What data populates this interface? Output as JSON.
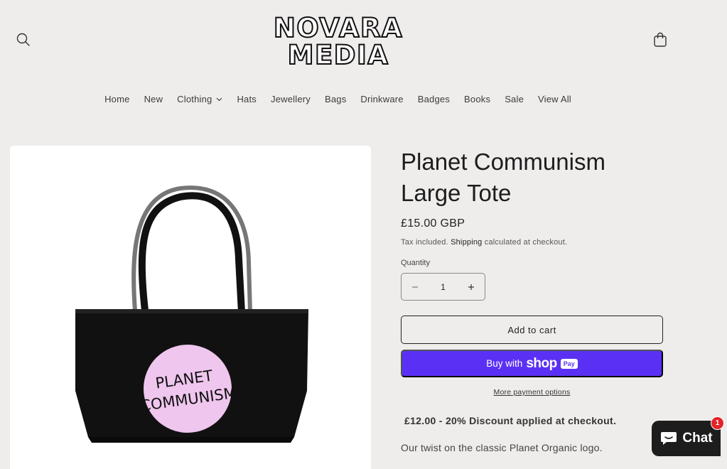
{
  "brand": {
    "logo_line1": "NOVARA",
    "logo_line2": "MEDIA"
  },
  "nav": {
    "items": [
      "Home",
      "New",
      "Clothing",
      "Hats",
      "Jewellery",
      "Bags",
      "Drinkware",
      "Badges",
      "Books",
      "Sale",
      "View All"
    ]
  },
  "product": {
    "title": "Planet Communism Large Tote",
    "price": "£15.00 GBP",
    "tax_prefix": "Tax included.",
    "tax_link": "Shipping",
    "tax_suffix": "calculated at checkout.",
    "quantity_label": "Quantity",
    "quantity_value": "1",
    "add_to_cart": "Add to cart",
    "buy_with": "Buy with",
    "shop_word": "shop",
    "pay_word": "Pay",
    "more_payment": "More payment options",
    "discount": "£12.00 - 20% Discount applied at checkout.",
    "description": "Our twist on the classic Planet Organic logo.",
    "image_text_line1": "PLANET",
    "image_text_line2": "COMMUNISM"
  },
  "chat": {
    "label": "Chat",
    "badge": "1"
  },
  "icons": {
    "search": "search-icon",
    "cart": "shopping-bag-icon",
    "chevron": "chevron-down-icon",
    "minus": "minus-icon",
    "plus": "plus-icon",
    "chat": "chat-bubble-icon"
  },
  "colors": {
    "background": "#efedec",
    "shop_pay": "#5a31f4",
    "chat_button": "#1d1d1d",
    "badge": "#e3232a",
    "logo_pink": "#efc6ee"
  }
}
